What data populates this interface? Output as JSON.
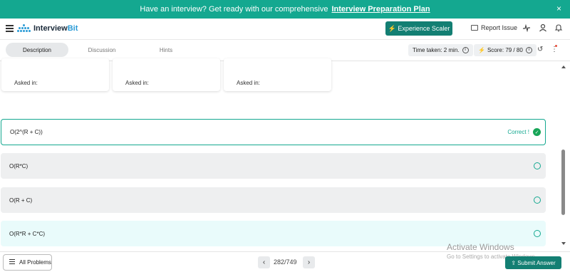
{
  "banner": {
    "text": "Have an interview? Get ready with our comprehensive",
    "link": "Interview Preparation Plan",
    "close": "×"
  },
  "header": {
    "logo_part1": "Interview",
    "logo_part2": "Bit",
    "experience_button": "⚡ Experience Scaler",
    "report_issue": "Report Issue",
    "icons": [
      "activity-icon",
      "user-icon",
      "bell-icon"
    ]
  },
  "tabs": [
    {
      "label": "Description",
      "active": true
    },
    {
      "label": "Discussion",
      "active": false
    },
    {
      "label": "Hints",
      "active": false
    }
  ],
  "toolbar": {
    "time_taken": "Time taken: 2 min.",
    "score": "Score: 79 / 80",
    "info": "i",
    "refresh": "↺",
    "more": "⋮"
  },
  "cards": [
    {
      "asked_in": "Asked in:"
    },
    {
      "asked_in": "Asked in:"
    },
    {
      "asked_in": "Asked in:"
    }
  ],
  "options": [
    {
      "text": "O(2^(R + C))",
      "state": "correct",
      "correct_label": "Correct !"
    },
    {
      "text": "O(R*C)",
      "state": "unselected"
    },
    {
      "text": "O(R + C)",
      "state": "unselected"
    },
    {
      "text": "O(R*R + C*C)",
      "state": "hover"
    }
  ],
  "bottom": {
    "all_problems": "All Problems",
    "prev": "‹",
    "next": "›",
    "pager": "282/749",
    "submit": "⇪ Submit Answer"
  },
  "watermark": {
    "title": "Activate Windows",
    "subtitle": "Go to Settings to activate Windows."
  },
  "colors": {
    "accent": "#14a890",
    "button": "#137f73",
    "correct": "#18a558"
  }
}
